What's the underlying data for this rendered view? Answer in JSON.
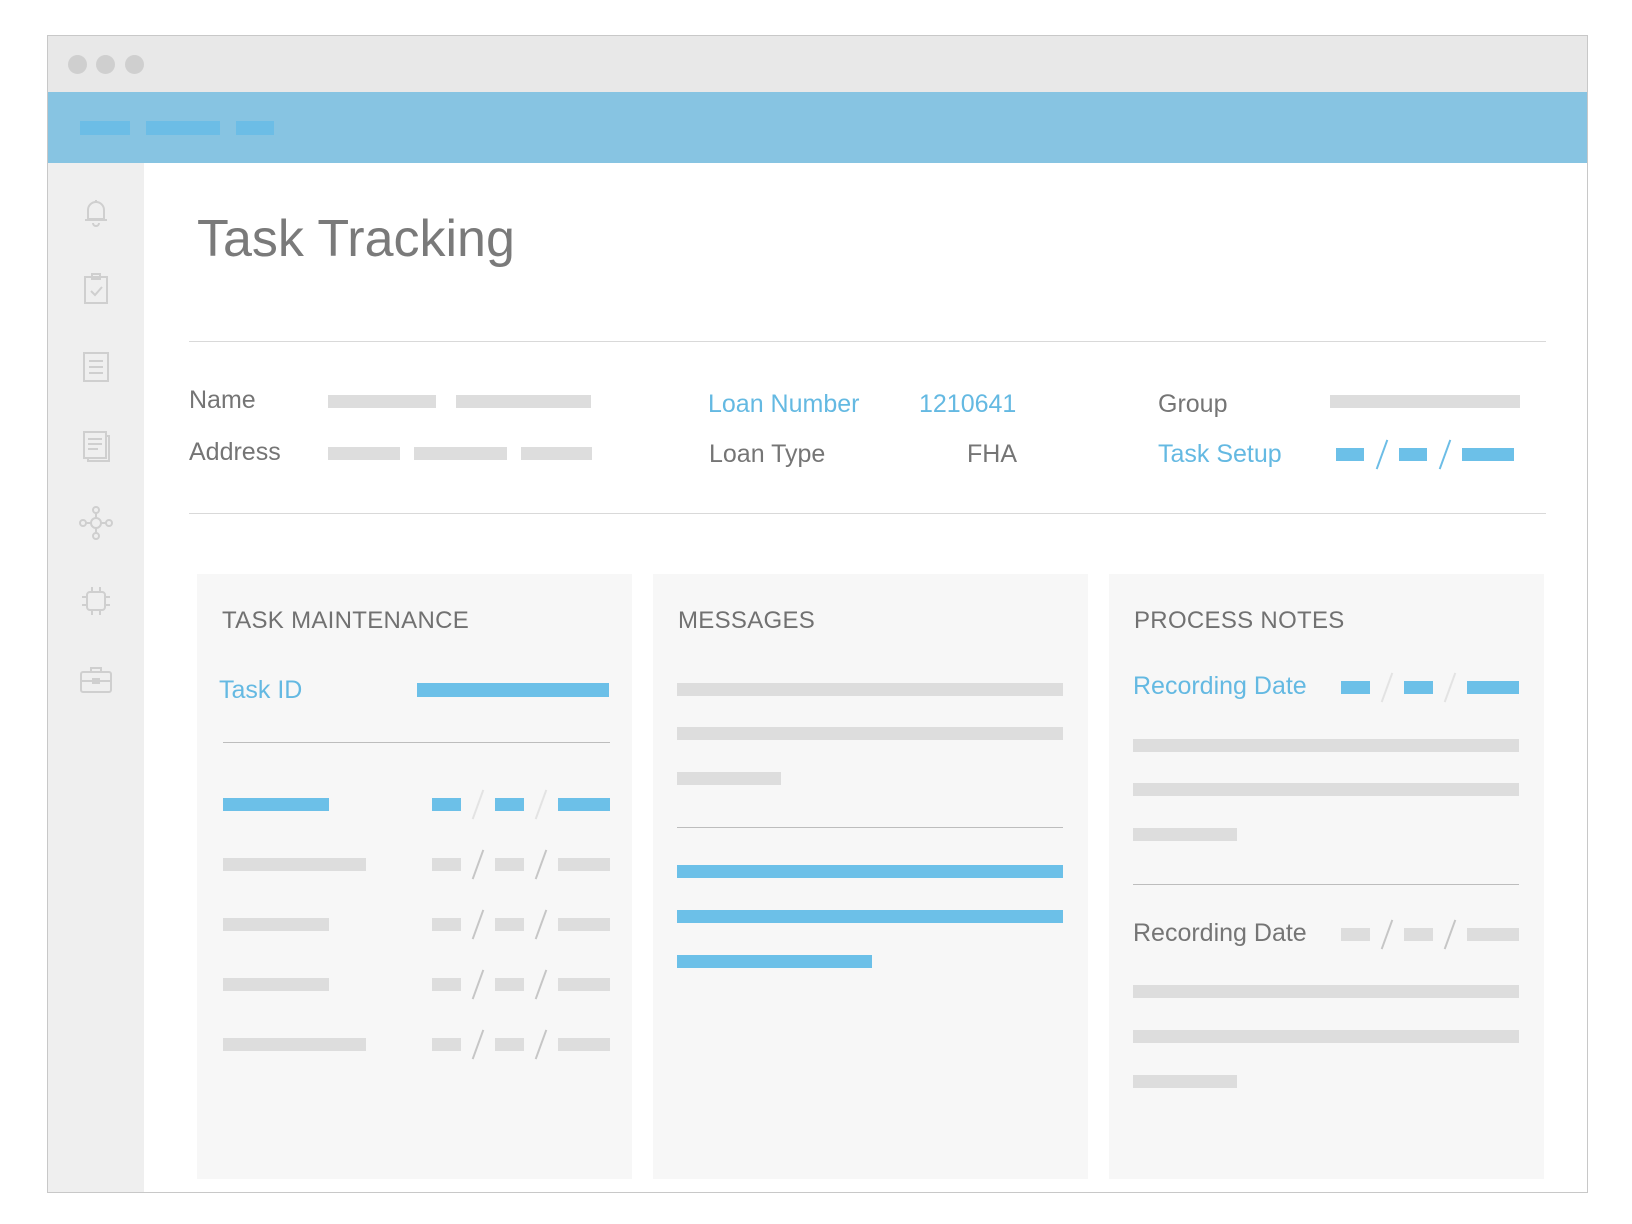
{
  "window": {
    "controls": [
      "close",
      "minimize",
      "maximize"
    ]
  },
  "sidebar": {
    "icons": [
      "bell-icon",
      "clipboard-check-icon",
      "list-icon",
      "document-icon",
      "network-icon",
      "chip-icon",
      "briefcase-icon"
    ]
  },
  "page": {
    "title": "Task Tracking"
  },
  "info": {
    "name_label": "Name",
    "address_label": "Address",
    "loan_number_label": "Loan Number",
    "loan_number_value": "1210641",
    "loan_type_label": "Loan Type",
    "loan_type_value": "FHA",
    "group_label": "Group",
    "task_setup_label": "Task Setup"
  },
  "panels": {
    "task_maintenance": {
      "title": "TASK MAINTENANCE",
      "task_id_label": "Task ID"
    },
    "messages": {
      "title": "MESSAGES"
    },
    "process_notes": {
      "title": "PROCESS NOTES",
      "recording_date_label_1": "Recording Date",
      "recording_date_label_2": "Recording Date"
    }
  },
  "colors": {
    "accent": "#64b9e2",
    "header_bar": "#87c4e2",
    "placeholder": "#dddddd",
    "panel_bg": "#f7f7f7"
  }
}
